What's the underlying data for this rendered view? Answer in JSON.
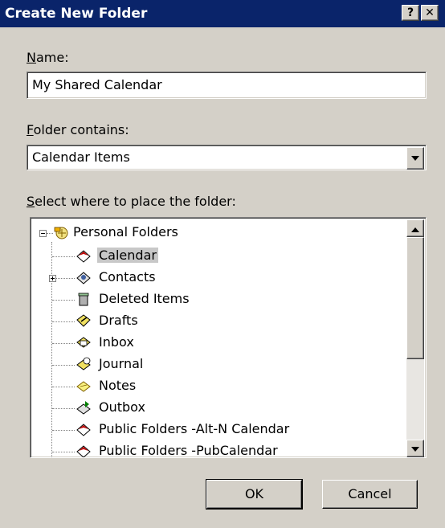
{
  "window": {
    "title": "Create New Folder",
    "help_label": "?",
    "close_label": "✕"
  },
  "name_field": {
    "label_access": "N",
    "label_rest": "ame:",
    "value": "My Shared Calendar"
  },
  "contains_field": {
    "label_access": "F",
    "label_rest": "older contains:",
    "selected": "Calendar Items"
  },
  "location": {
    "label_access": "S",
    "label_rest": "elect where to place the folder:",
    "root": "Personal Folders",
    "items": [
      {
        "label": "Calendar",
        "icon": "calendar-icon",
        "selected": true
      },
      {
        "label": "Contacts",
        "icon": "contacts-icon",
        "expandable": true
      },
      {
        "label": "Deleted Items",
        "icon": "deleted-items-icon"
      },
      {
        "label": "Drafts",
        "icon": "drafts-icon"
      },
      {
        "label": "Inbox",
        "icon": "inbox-icon"
      },
      {
        "label": "Journal",
        "icon": "journal-icon"
      },
      {
        "label": "Notes",
        "icon": "notes-icon"
      },
      {
        "label": "Outbox",
        "icon": "outbox-icon"
      },
      {
        "label": "Public Folders -Alt-N Calendar",
        "icon": "calendar-icon"
      },
      {
        "label": "Public Folders -PubCalendar",
        "icon": "calendar-icon"
      }
    ]
  },
  "buttons": {
    "ok": "OK",
    "cancel": "Cancel"
  }
}
